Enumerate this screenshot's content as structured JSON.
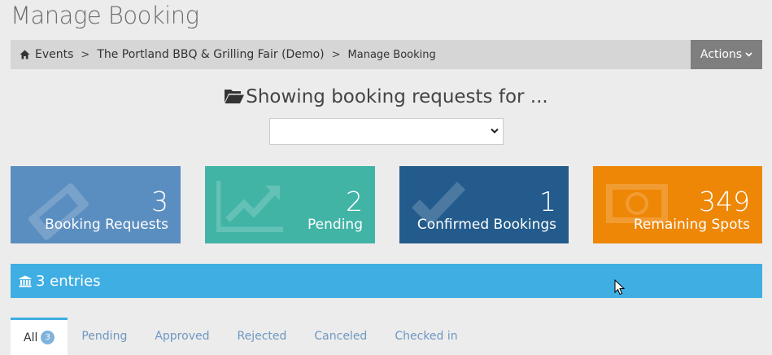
{
  "page": {
    "title": "Manage Booking"
  },
  "breadcrumb": {
    "items": [
      "Events",
      "The Portland BBQ & Grilling Fair (Demo)",
      "Manage Booking"
    ],
    "separator": ">"
  },
  "actions": {
    "label": "Actions"
  },
  "filter": {
    "heading": "Showing booking requests for ...",
    "selected_value": ""
  },
  "stats": [
    {
      "value": "3",
      "label": "Booking Requests",
      "color": "#5b8ec0",
      "icon": "ticket-icon"
    },
    {
      "value": "2",
      "label": "Pending",
      "color": "#41b4a6",
      "icon": "chart-line-icon"
    },
    {
      "value": "1",
      "label": "Confirmed Bookings",
      "color": "#235b8c",
      "icon": "check-icon"
    },
    {
      "value": "349",
      "label": "Remaining Spots",
      "color": "#ee8606",
      "icon": "money-icon"
    }
  ],
  "entries": {
    "label": "3 entries",
    "color": "#3faee2"
  },
  "tabs": [
    {
      "label": "All",
      "badge": "3",
      "active": true
    },
    {
      "label": "Pending"
    },
    {
      "label": "Approved"
    },
    {
      "label": "Rejected"
    },
    {
      "label": "Canceled"
    },
    {
      "label": "Checked in"
    }
  ]
}
